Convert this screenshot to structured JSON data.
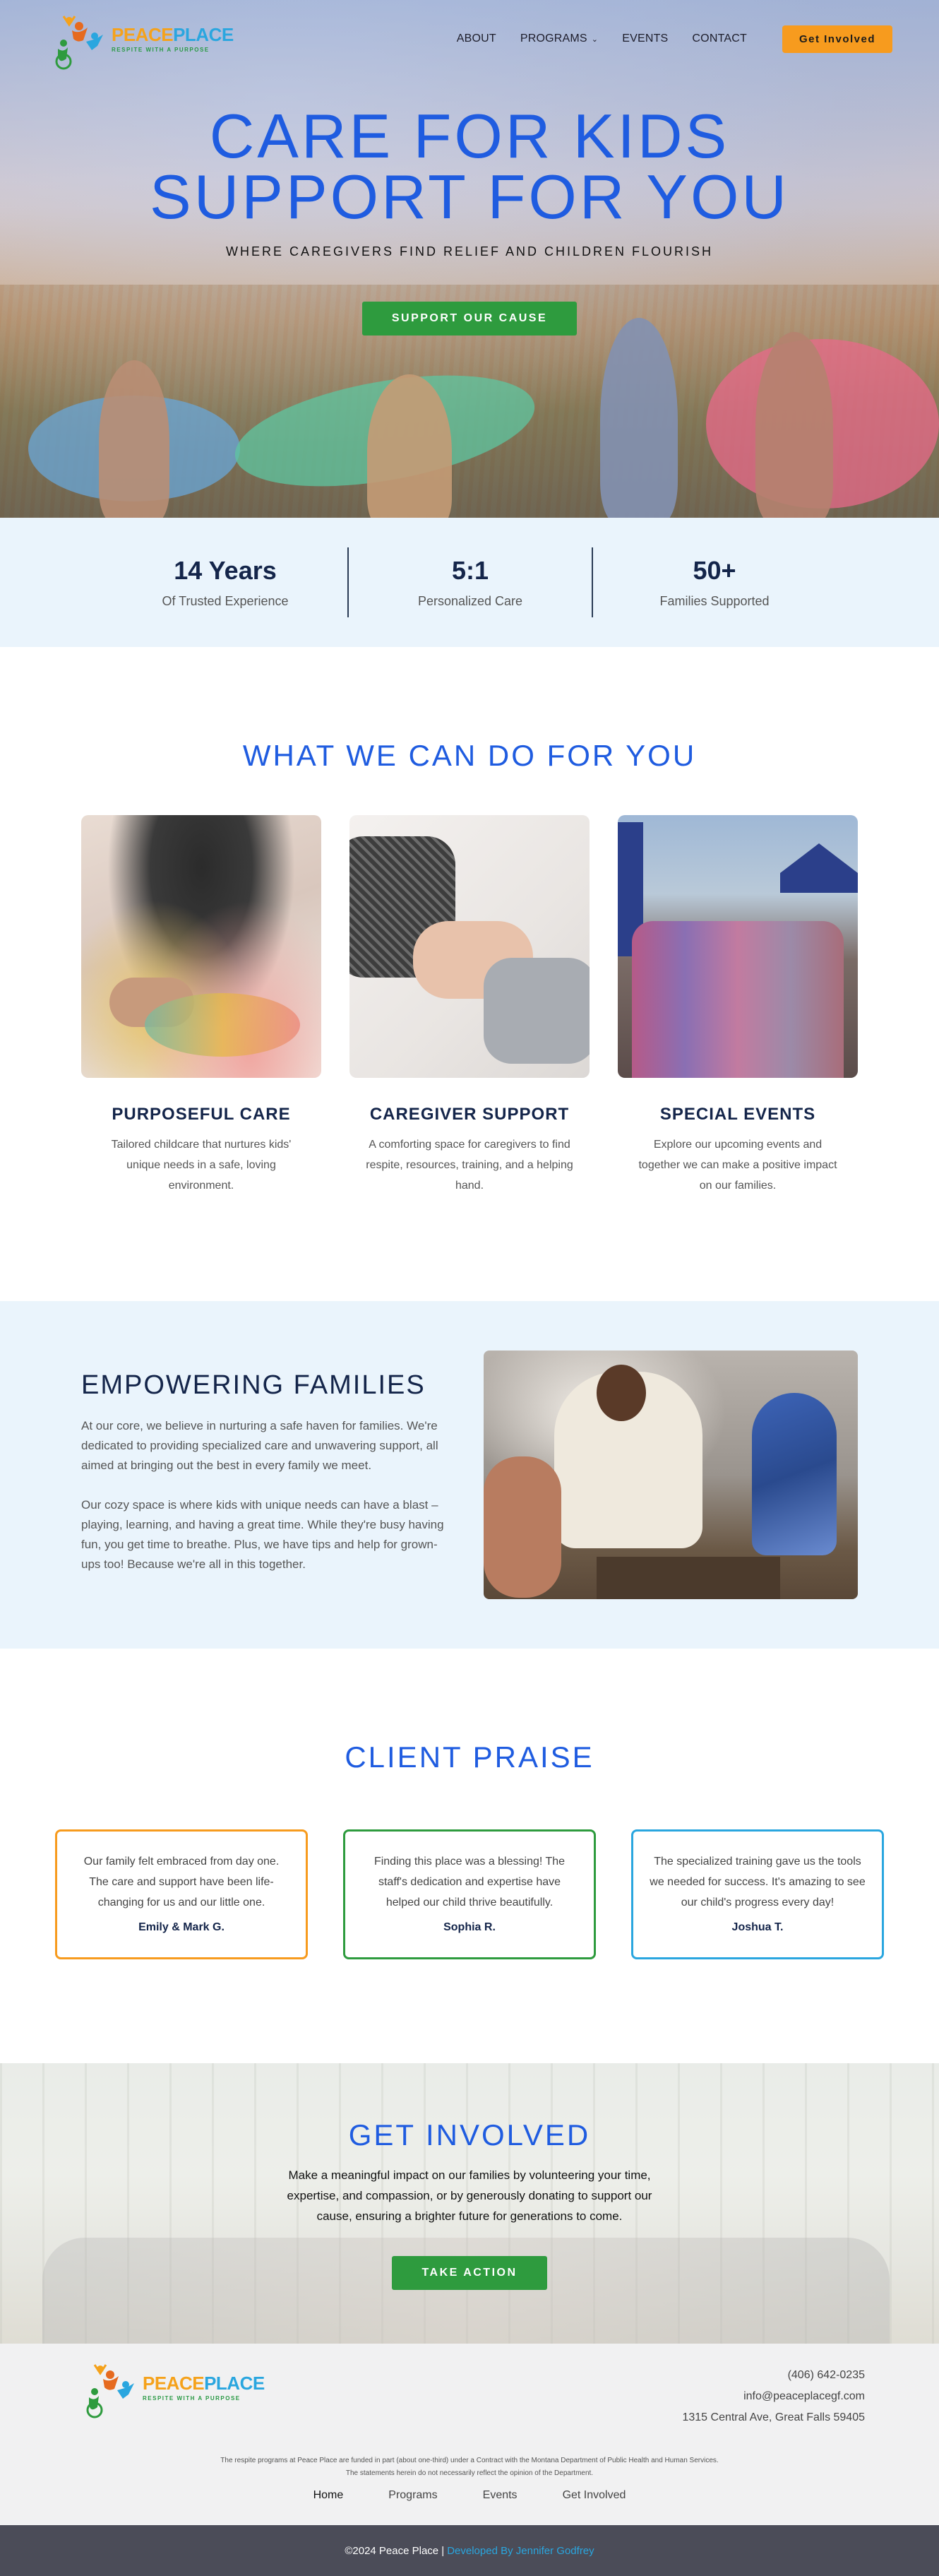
{
  "nav": {
    "logo": {
      "name_part1": "PEACE",
      "name_part2": "PLACE",
      "tagline": "RESPITE WITH A PURPOSE"
    },
    "items": [
      {
        "label": "ABOUT"
      },
      {
        "label": "PROGRAMS"
      },
      {
        "label": "EVENTS"
      },
      {
        "label": "CONTACT"
      }
    ],
    "cta_label": "Get Involved"
  },
  "hero": {
    "title_line1": "CARE FOR KIDS",
    "title_line2": "SUPPORT FOR YOU",
    "subtitle": "WHERE CAREGIVERS FIND RELIEF AND CHILDREN FLOURISH",
    "button_label": "SUPPORT OUR CAUSE"
  },
  "stats": [
    {
      "number": "14 Years",
      "label": "Of Trusted Experience"
    },
    {
      "number": "5:1",
      "label": "Personalized Care"
    },
    {
      "number": "50+",
      "label": "Families Supported"
    }
  ],
  "services": {
    "title": "WHAT WE CAN DO FOR YOU",
    "cards": [
      {
        "title": "PURPOSEFUL CARE",
        "text": "Tailored childcare that nurtures kids' unique needs in a safe, loving environment."
      },
      {
        "title": "CAREGIVER SUPPORT",
        "text": "A comforting space for caregivers to find respite, resources, training, and a helping hand."
      },
      {
        "title": "SPECIAL EVENTS",
        "text": "Explore our upcoming events and together we can make a positive impact on our families."
      }
    ]
  },
  "empower": {
    "title": "EMPOWERING FAMILIES",
    "p1": "At our core, we believe in nurturing a safe haven for families. We're dedicated to providing specialized care and unwavering support, all aimed at bringing out the best in every family we meet.",
    "p2": "Our cozy space is where kids with unique needs can have a blast – playing, learning, and having a great time. While they're busy having fun, you get time to breathe. Plus, we have tips and help for grown-ups too! Because we're all in this together."
  },
  "praise": {
    "title": "CLIENT PRAISE",
    "cards": [
      {
        "quote": "Our family felt embraced from day one. The care and support have been life-changing for us and our little one.",
        "author": "Emily & Mark G.",
        "border": "#f79b1e"
      },
      {
        "quote": "Finding this place was a blessing! The staff's dedication and expertise have helped our child thrive beautifully.",
        "author": "Sophia R.",
        "border": "#2e9b3e"
      },
      {
        "quote": "The specialized training gave us the tools we needed for success. It's amazing to see our child's progress every day!",
        "author": "Joshua T.",
        "border": "#2aa6df"
      }
    ]
  },
  "involved": {
    "title": "GET INVOLVED",
    "text": "Make a meaningful impact on our families by volunteering your time, expertise, and compassion, or by generously donating to support our cause, ensuring a brighter future for generations to come.",
    "button_label": "TAKE ACTION"
  },
  "footer": {
    "phone": "(406) 642-0235",
    "email": "info@peaceplacegf.com",
    "address": "1315 Central Ave, Great Falls 59405",
    "note_line1": "The respite programs at Peace Place are funded in part (about one-third) under a Contract with the Montana Department of Public Health and Human Services.",
    "note_line2": "The statements herein do not necessarily reflect the opinion of the Department.",
    "links": [
      {
        "label": "Home"
      },
      {
        "label": "Programs"
      },
      {
        "label": "Events"
      },
      {
        "label": "Get Involved"
      }
    ],
    "copyright": "©2024 Peace Place |",
    "developer": "Developed By Jennifer Godfrey"
  },
  "colors": {
    "brand_blue": "#1f5ce0",
    "navy": "#14254a",
    "green": "#2e9b3e",
    "orange": "#f79b1e",
    "sky": "#2aa6df"
  }
}
